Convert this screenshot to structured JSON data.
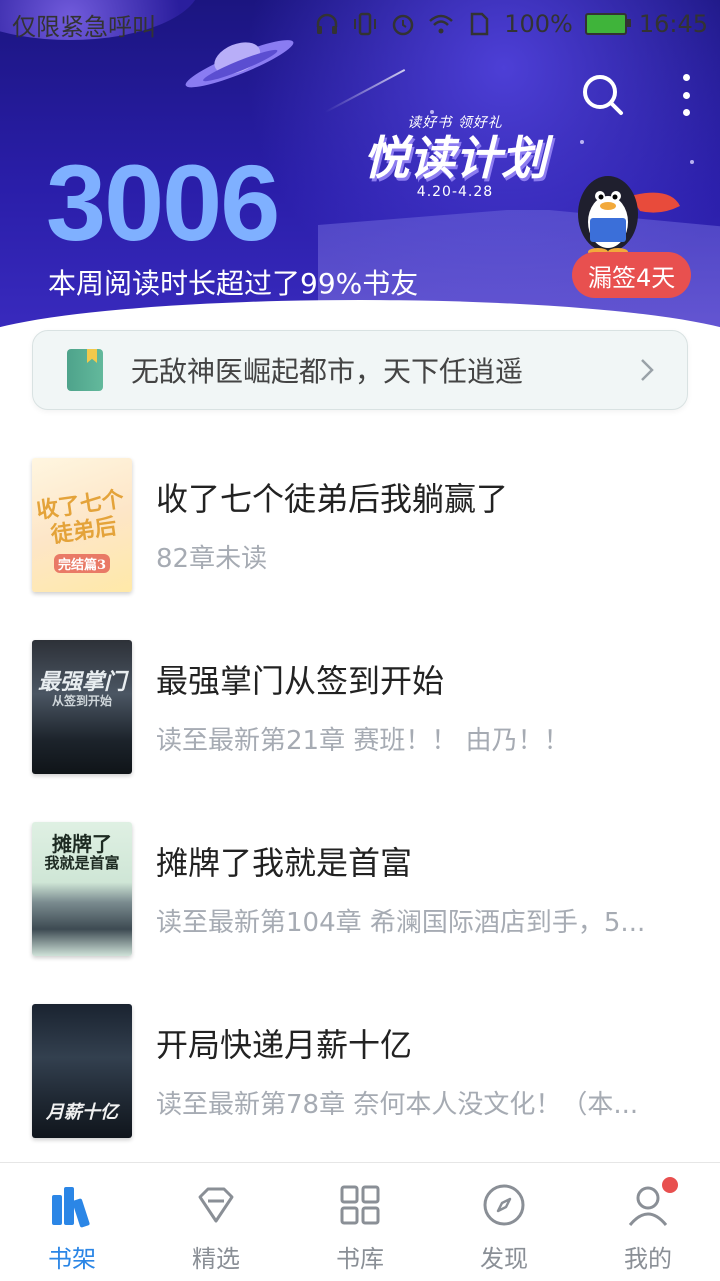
{
  "status_bar": {
    "left_text": "仅限紧急呼叫",
    "battery": "100%",
    "time": "16:45"
  },
  "header": {
    "campaign": {
      "subtitle": "读好书 领好礼",
      "title": "悦读计划",
      "dates": "4.20-4.28"
    },
    "reading_minutes": "3006",
    "reading_caption": "本周阅读时长超过了99%书友",
    "missed_checkin": "漏签4天",
    "icons": [
      "search-icon",
      "more-vertical-icon"
    ]
  },
  "recommendation": {
    "text": "无敌神医崛起都市，天下任逍遥"
  },
  "books": [
    {
      "title": "收了七个徒弟后我躺赢了",
      "subtitle": "82章未读",
      "cover_text": "收了七个徒弟后",
      "cover_tag": "完结篇3"
    },
    {
      "title": "最强掌门从签到开始",
      "subtitle": "读至最新第21章 赛班！！ 由乃！！",
      "cover_text": "最强掌门",
      "cover_tag": "从签到开始"
    },
    {
      "title": "摊牌了我就是首富",
      "subtitle": "读至最新第104章 希澜国际酒店到手，5...",
      "cover_text": "摊牌了",
      "cover_tag": "我就是首富"
    },
    {
      "title": "开局快递月薪十亿",
      "subtitle": "读至最新第78章 奈何本人没文化！（本...",
      "cover_text": "月薪十亿",
      "cover_tag": ""
    }
  ],
  "nav": [
    {
      "label": "书架",
      "icon": "bookshelf-icon",
      "active": true
    },
    {
      "label": "精选",
      "icon": "diamond-icon",
      "active": false
    },
    {
      "label": "书库",
      "icon": "grid-icon",
      "active": false
    },
    {
      "label": "发现",
      "icon": "compass-icon",
      "active": false
    },
    {
      "label": "我的",
      "icon": "profile-icon",
      "active": false
    }
  ],
  "colors": {
    "accent": "#2b86e6",
    "badge": "#e8504f",
    "hero_bg": "#2a1ea9",
    "reading_number": "#7fb0ff"
  }
}
